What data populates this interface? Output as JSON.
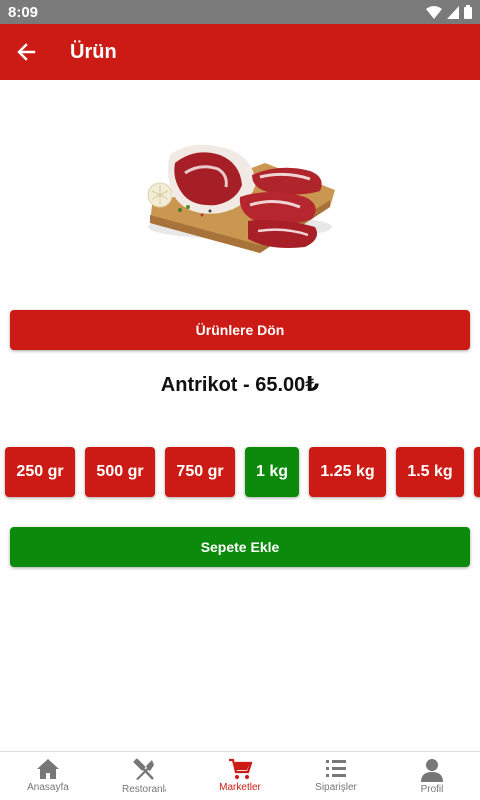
{
  "status_bar": {
    "time": "8:09"
  },
  "app_bar": {
    "title": "Ürün"
  },
  "product": {
    "image": "ribeye-steak-board",
    "name_price": "Antrikot - 65.00₺"
  },
  "buttons": {
    "back_to_products": "Ürünlere Dön",
    "add_to_cart": "Sepete Ekle"
  },
  "weights": [
    {
      "label": "250 gr",
      "selected": false
    },
    {
      "label": "500 gr",
      "selected": false
    },
    {
      "label": "750 gr",
      "selected": false
    },
    {
      "label": "1 kg",
      "selected": true
    },
    {
      "label": "1.25 kg",
      "selected": false
    },
    {
      "label": "1.5 kg",
      "selected": false
    },
    {
      "label": "",
      "selected": false
    }
  ],
  "bottom_nav": [
    {
      "label": "Anasayfa",
      "icon": "home-icon",
      "active": false
    },
    {
      "label": "Restoranlar",
      "icon": "utensils-icon",
      "active": false
    },
    {
      "label": "Marketler",
      "icon": "cart-icon",
      "active": true
    },
    {
      "label": "Siparişler",
      "icon": "list-icon",
      "active": false
    },
    {
      "label": "Profil",
      "icon": "person-icon",
      "active": false
    }
  ],
  "colors": {
    "primary": "#cc1b14",
    "success": "#0b8a0b",
    "status_bar": "#7a7a7a"
  }
}
